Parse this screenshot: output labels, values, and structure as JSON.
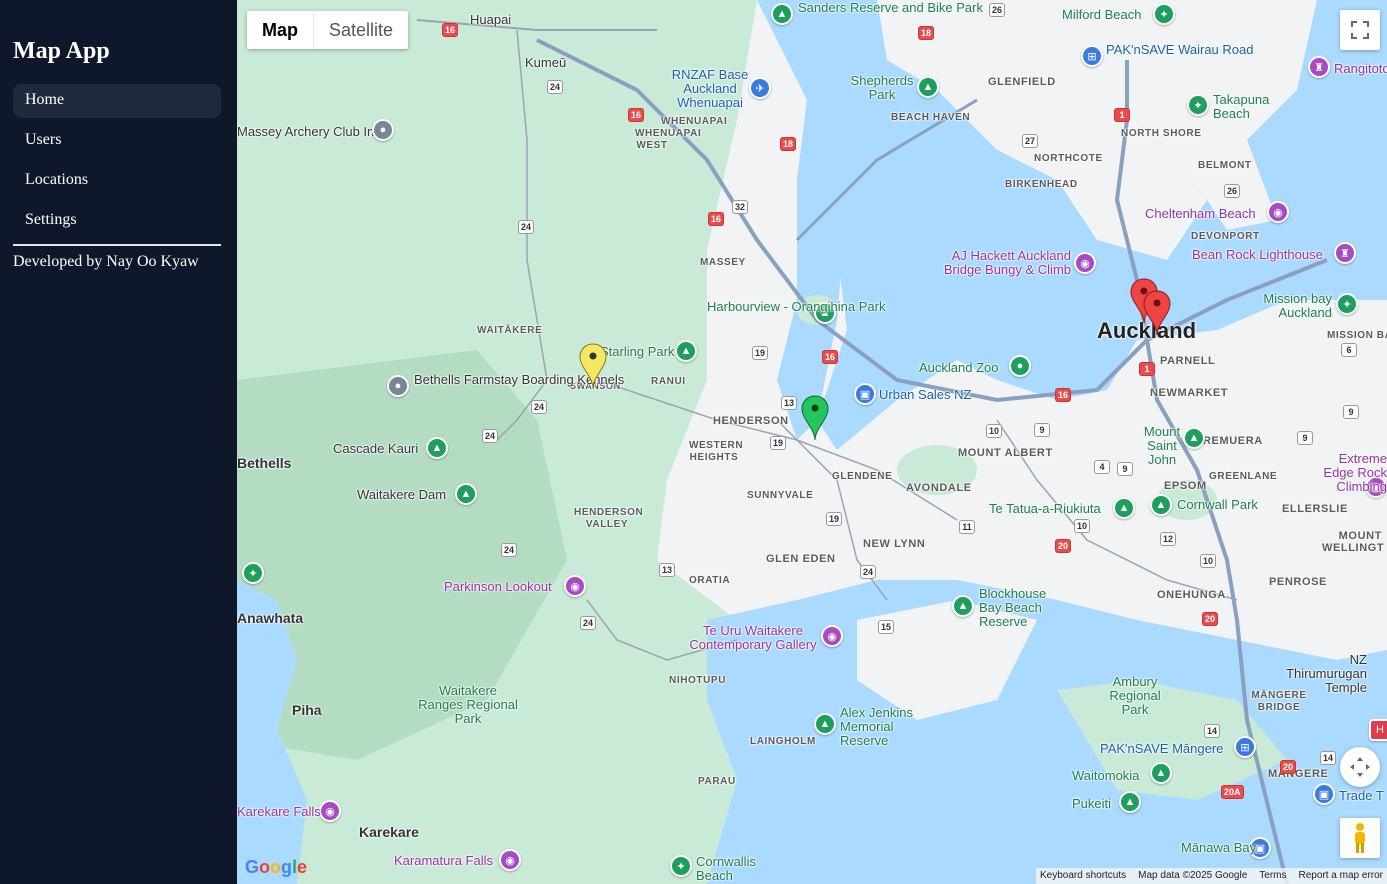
{
  "app": {
    "title": "Map App",
    "footer": "Developed by Nay Oo Kyaw"
  },
  "nav": [
    {
      "label": "Home",
      "active": true
    },
    {
      "label": "Users",
      "active": false
    },
    {
      "label": "Locations",
      "active": false
    },
    {
      "label": "Settings",
      "active": false
    }
  ],
  "map": {
    "type_buttons": {
      "map": "Map",
      "satellite": "Satellite",
      "selected": "Map"
    },
    "city_label": "Auckland",
    "labels": {
      "huapai": "Huapai",
      "kumeu": "Kumeū",
      "rnzaf": "RNZAF Base Auckland Whenuapai",
      "whenuapai": "WHENUAPAI",
      "whenuapai_west": "WHENUAPAI WEST",
      "massey": "MASSEY",
      "archery": "Massey Archery Club Inc",
      "waitakere": "WAITĀKERE",
      "swanson": "SWANSON",
      "ranui": "RANUI",
      "henderson": "HENDERSON",
      "western_heights": "WESTERN HEIGHTS",
      "glendene": "GLENDENE",
      "sunnyvale": "SUNNYVALE",
      "henderson_valley": "HENDERSON VALLEY",
      "glen_eden": "GLEN EDEN",
      "new_lynn": "NEW LYNN",
      "oratia": "ORATIA",
      "nihotupu": "NIHOTUPU",
      "laingholm": "LAINGHOLM",
      "parau": "PARAU",
      "avondale": "AVONDALE",
      "mount_albert": "MOUNT ALBERT",
      "parnell": "PARNELL",
      "newmarket": "NEWMARKET",
      "remuera": "REMUERA",
      "epsom": "EPSOM",
      "ellerslie": "ELLERSLIE",
      "greenlane": "GREENLANE",
      "onehunga": "ONEHUNGA",
      "penrose": "PENROSE",
      "mangere": "MĀNGERE",
      "mangere_bridge": "MĀNGERE BRIDGE",
      "glenfield": "GLENFIELD",
      "beach_haven": "BEACH HAVEN",
      "birkenhead": "BIRKENHEAD",
      "northcote": "NORTHCOTE",
      "north_shore": "NORTH SHORE",
      "belmont": "BELMONT",
      "devonport": "DEVONPORT",
      "mission_bay_sub": "MISSION BAY",
      "piha": "Piha",
      "karekare": "Karekare",
      "anawhata": "Anawhata",
      "bethells_farmstay": "Bethells Farmstay Boarding Kennels",
      "cascade_kauri": "Cascade Kauri",
      "waitakere_dam": "Waitakere Dam",
      "parkinson_lookout": "Parkinson Lookout",
      "te_uru": "Te Uru Waitakere Contemporary Gallery",
      "waitakere_ranges": "Waitakere Ranges Regional Park",
      "alex_jenkins": "Alex Jenkins Memorial Reserve",
      "harbourview": "Harbourview - Orangihina Park",
      "sanders_reserve": "Sanders Reserve and Bike Park",
      "shepherds_park": "Shepherds Park",
      "milford_beach": "Milford Beach",
      "paknsave_wairau": "PAK'nSAVE Wairau Road",
      "takapuna_beach": "Takapuna Beach",
      "rangitoto": "Rangitoto",
      "cheltenham": "Cheltenham Beach",
      "aj_hackett": "AJ Hackett Auckland Bridge Bungy & Climb",
      "bean_rock": "Bean Rock Lighthouse",
      "mission_bay": "Mission bay Auckland",
      "auckland_zoo": "Auckland Zoo",
      "urban_sales": "Urban Sales NZ",
      "mount_saint_john": "Mount Saint John",
      "extreme_edge": "Extreme Edge Rock Climbing",
      "te_tatua": "Te Tatua-a-Riukiuta",
      "cornwall_park": "Cornwall Park",
      "blockhouse_bay": "Blockhouse Bay Beach Reserve",
      "thirumurugan": "NZ Thirumurugan Temple",
      "ambury": "Ambury Regional Park",
      "paknsave_mangere": "PAK'nSAVE Māngere",
      "waitomokia": "Waitomokia",
      "pukeiti": "Pukeiti",
      "manawa_bay": "Mānawa Bay",
      "trade_tools": "Trade T",
      "karamatura": "Karamatura Falls",
      "karekare_falls": "Karekare Falls",
      "cornwallis": "Cornwallis Beach",
      "darling_park": "Starling Park",
      "mount_wellington": "MOUNT WELLINGT",
      "bethells": "Bethells"
    },
    "attribution": {
      "shortcuts": "Keyboard shortcuts",
      "data": "Map data ©2025 Google",
      "terms": "Terms",
      "report": "Report a map error"
    },
    "logo": "Google",
    "markers": [
      {
        "color": "#f5e663",
        "name": "yellow"
      },
      {
        "color": "#22c55e",
        "name": "green"
      },
      {
        "color": "#ef4444",
        "name": "red"
      },
      {
        "color": "#ef4444",
        "name": "red"
      }
    ]
  }
}
